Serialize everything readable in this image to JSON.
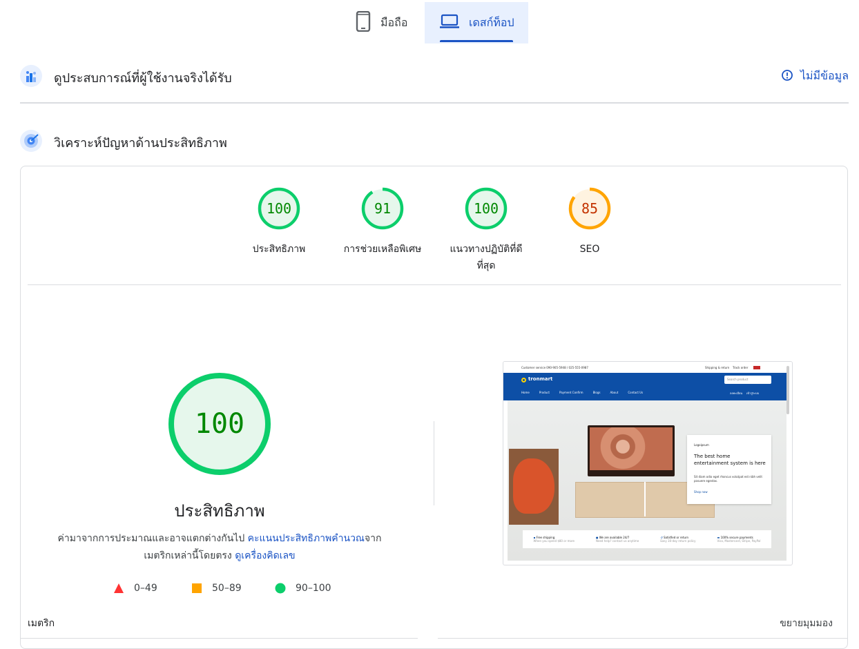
{
  "tabs": [
    {
      "label": "มือถือ",
      "icon": "smartphone-icon",
      "active": false
    },
    {
      "label": "เดสก์ท็อป",
      "icon": "laptop-icon",
      "active": true
    }
  ],
  "field_data": {
    "title": "ดูประสบการณ์ที่ผู้ใช้งานจริงได้รับ",
    "status": "ไม่มีข้อมูล"
  },
  "diagnose": {
    "title": "วิเคราะห์ปัญหาด้านประสิทธิภาพ"
  },
  "scores": [
    {
      "value": "100",
      "label": "ประสิทธิภาพ",
      "score": 100,
      "color": "#0cce6b",
      "text_color": "#008800",
      "fill": "#e6f7ec"
    },
    {
      "value": "91",
      "label": "การช่วยเหลือพิเศษ",
      "score": 91,
      "color": "#0cce6b",
      "text_color": "#008800",
      "fill": "#e6f7ec"
    },
    {
      "value": "100",
      "label_line1": "แนวทางปฏิบัติที่ดี",
      "label_line2": "ที่สุด",
      "score": 100,
      "color": "#0cce6b",
      "text_color": "#008800",
      "fill": "#e6f7ec"
    },
    {
      "value": "85",
      "label": "SEO",
      "score": 85,
      "color": "#ffa400",
      "text_color": "#c33300",
      "fill": "#fff3e0"
    }
  ],
  "main_score": {
    "value": "100",
    "score": 100,
    "title": "ประสิทธิภาพ",
    "desc_part1": "ค่ามาจากการประมาณและอาจแตกต่างกันไป ",
    "desc_link1": "คะแนนประสิทธิภาพคำนวณ",
    "desc_part2": "จาก",
    "desc_part3": "เมตริกเหล่านี้โดยตรง ",
    "desc_link2": "ดูเครื่องคิดเลข"
  },
  "legend": [
    {
      "range": "0–49",
      "shape": "triangle",
      "color": "#ff3333"
    },
    {
      "range": "50–89",
      "shape": "square",
      "color": "#ffa400"
    },
    {
      "range": "90–100",
      "shape": "circle",
      "color": "#0cce6b"
    }
  ],
  "footer": {
    "metrics_label": "เมตริก",
    "expand_label": "ขยายมุมมอง"
  },
  "screenshot": {
    "topbar": "Customer service 090-905-5948 / 025-555-0987",
    "topbar_right1": "Shipping & return",
    "topbar_right2": "Track order",
    "logo": "tronmart",
    "search_placeholder": "Search product",
    "nav": [
      "Home",
      "Product",
      "Payment Confirm",
      "Blogs",
      "About",
      "Contact Us"
    ],
    "account": "ลงทะเบียน",
    "login": "เข้าสู่ระบบ",
    "promo_brand": "Logoipsum",
    "promo_title": "The best home entertainment system is here",
    "promo_body": "Sit diam odio eget rhoncus volutpat est nibh velit posuere egestas.",
    "promo_cta": "Shop now",
    "features": [
      {
        "title": "Free shipping",
        "sub": "When you spend $80 or more"
      },
      {
        "title": "We are available 24/7",
        "sub": "Need help? contact us anytime"
      },
      {
        "title": "Satisfied or return",
        "sub": "Easy 30-day return policy"
      },
      {
        "title": "100% secure payments",
        "sub": "Visa, Mastercard, Stripe, PayPal"
      }
    ]
  },
  "colors": {
    "accent": "#1a53c4",
    "pass": "#0cce6b",
    "average": "#ffa400",
    "fail": "#ff3333",
    "site_blue": "#0d4fa6"
  }
}
